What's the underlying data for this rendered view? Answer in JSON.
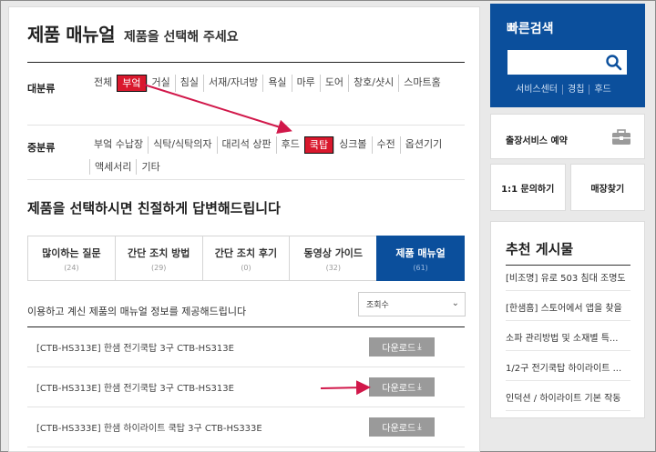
{
  "page": {
    "title": "제품 매뉴얼",
    "subtitle": "제품을 선택해 주세요"
  },
  "major": {
    "label": "대분류",
    "items": [
      "전체",
      "부엌",
      "거실",
      "침실",
      "서재/자녀방",
      "욕실",
      "마루",
      "도어",
      "창호/샷시",
      "스마트홈"
    ],
    "active": "부엌"
  },
  "minor": {
    "label": "중분류",
    "items": [
      "부엌 수납장",
      "식탁/식탁의자",
      "대리석 상판",
      "후드",
      "쿡탑",
      "싱크볼",
      "수전",
      "옵션기기",
      "액세서리",
      "기타"
    ],
    "active": "쿡탑"
  },
  "section": {
    "heading": "제품을 선택하시면 친절하게 답변해드립니다"
  },
  "tabs": [
    {
      "label": "많이하는 질문",
      "count": "(24)"
    },
    {
      "label": "간단 조치 방법",
      "count": "(29)"
    },
    {
      "label": "간단 조치 후기",
      "count": "(0)"
    },
    {
      "label": "동영상 가이드",
      "count": "(32)"
    },
    {
      "label": "제품 매뉴얼",
      "count": "(61)"
    }
  ],
  "info": {
    "text": "이용하고 계신 제품의 매뉴얼 정보를 제공해드립니다",
    "sort_value": "조회수"
  },
  "manuals": [
    {
      "title": "[CTB-HS313E] 한샘 전기쿡탑 3구 CTB-HS313E",
      "button": "다운로드"
    },
    {
      "title": "[CTB-HS313E] 한샘 전기쿡탑 3구 CTB-HS313E",
      "button": "다운로드"
    },
    {
      "title": "[CTB-HS333E] 한샘 하이라이트 쿡탑 3구 CTB-HS333E",
      "button": "다운로드"
    }
  ],
  "sidebar": {
    "quick_search": {
      "title": "빠른검색",
      "input_value": "",
      "links": [
        "서비스센터",
        "경칩",
        "후드"
      ]
    },
    "trip_service": "출장서비스 예약",
    "inquiry": "1:1 문의하기",
    "store": "매장찾기",
    "recommended": {
      "title": "추천 게시물",
      "items": [
        "[비조명] 유로 503 침대 조명도",
        "[한샘홈] 스토어에서 앱을 찾을",
        "소파 관리방법 및 소재별 특...",
        "1/2구 전기쿡탑 하이라이트 ...",
        "인덕션 / 하이라이트 기본 작동"
      ]
    }
  },
  "colors": {
    "accent_blue": "#0b4f9c",
    "active_red": "#d9182d",
    "annotation_arrow": "#d1184a",
    "button_gray": "#9a9a9a"
  }
}
